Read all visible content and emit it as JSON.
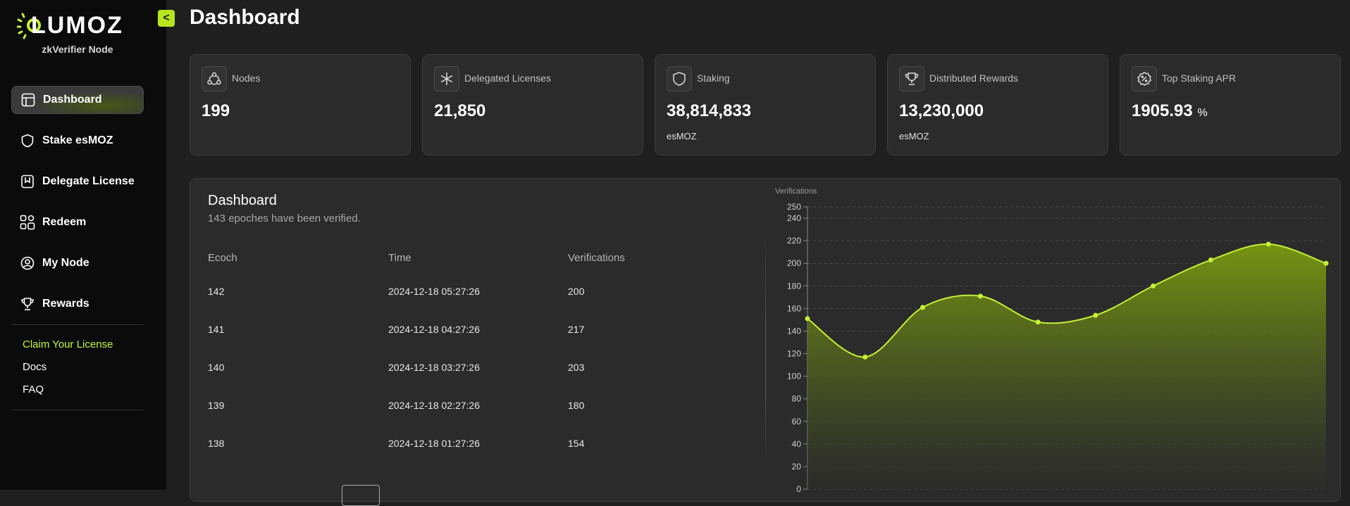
{
  "app": {
    "brand": "LUMOZ",
    "subtitle": "zkVerifier Node"
  },
  "sidebar": {
    "collapse_label": "<",
    "items": [
      {
        "label": "Dashboard",
        "icon": "layout-icon",
        "active": true
      },
      {
        "label": "Stake esMOZ",
        "icon": "shield-icon"
      },
      {
        "label": "Delegate License",
        "icon": "bookmark-icon"
      },
      {
        "label": "Redeem",
        "icon": "shapes-icon"
      },
      {
        "label": "My Node",
        "icon": "user-circle-icon"
      },
      {
        "label": "Rewards",
        "icon": "trophy-icon"
      }
    ],
    "links": [
      {
        "label": "Claim Your License",
        "color": "#c6f135"
      },
      {
        "label": "Docs"
      },
      {
        "label": "FAQ"
      }
    ]
  },
  "header": {
    "title": "Dashboard"
  },
  "stats": [
    {
      "label": "Nodes",
      "value": "199",
      "unit": "",
      "icon": "nodes-icon"
    },
    {
      "label": "Delegated Licenses",
      "value": "21,850",
      "unit": "",
      "icon": "asterisk-icon"
    },
    {
      "label": "Staking",
      "value": "38,814,833",
      "unit": "esMOZ",
      "icon": "shield-icon"
    },
    {
      "label": "Distributed Rewards",
      "value": "13,230,000",
      "unit": "esMOZ",
      "icon": "trophy-icon"
    },
    {
      "label": "Top Staking APR",
      "value": "1905.93",
      "suffix": "%",
      "unit": "",
      "icon": "percent-badge-icon"
    }
  ],
  "panel": {
    "title": "Dashboard",
    "subtitle": "143 epoches have been verified.",
    "columns": [
      "Ecoch",
      "Time",
      "Verifications"
    ],
    "rows": [
      {
        "epoch": "142",
        "time": "2024-12-18 05:27:26",
        "verifications": "200"
      },
      {
        "epoch": "141",
        "time": "2024-12-18 04:27:26",
        "verifications": "217"
      },
      {
        "epoch": "140",
        "time": "2024-12-18 03:27:26",
        "verifications": "203"
      },
      {
        "epoch": "139",
        "time": "2024-12-18 02:27:26",
        "verifications": "180"
      },
      {
        "epoch": "138",
        "time": "2024-12-18 01:27:26",
        "verifications": "154"
      }
    ]
  },
  "chart_data": {
    "type": "area",
    "ylabel": "Verifications",
    "ylim": [
      0,
      250
    ],
    "yticks": [
      0,
      20,
      40,
      60,
      80,
      100,
      120,
      140,
      160,
      180,
      200,
      220,
      240,
      250
    ],
    "grid": true,
    "color": "#c6f135",
    "values": [
      151,
      117,
      161,
      171,
      148,
      154,
      180,
      203,
      217,
      200
    ]
  },
  "colors": {
    "accent": "#c6f135",
    "background": "#1f1f1f",
    "sidebar": "#0b0b0b",
    "card": "#2b2b2b"
  }
}
